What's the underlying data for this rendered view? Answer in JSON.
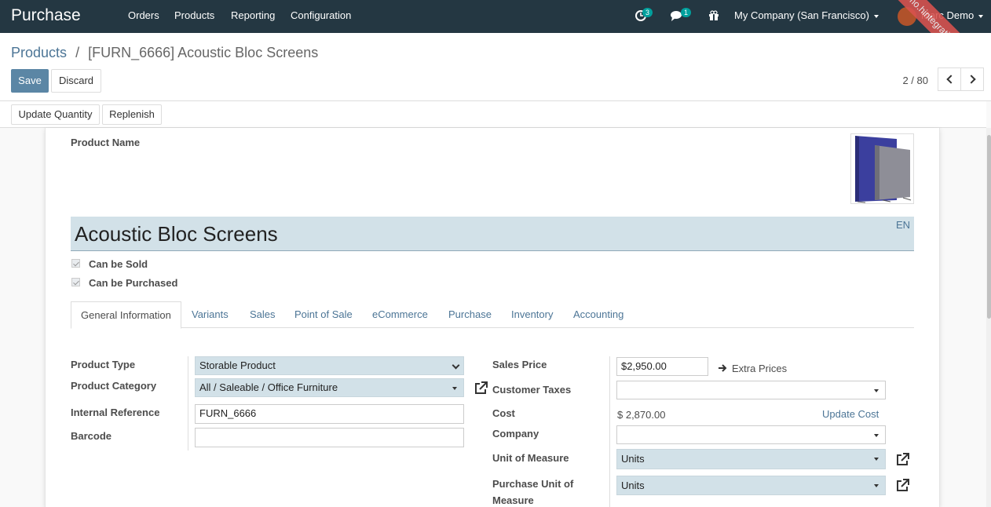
{
  "navbar": {
    "app_title": "Purchase",
    "menu": [
      "Orders",
      "Products",
      "Reporting",
      "Configuration"
    ],
    "activity_count": "3",
    "messages_count": "1",
    "company": "My Company (San Francisco)",
    "user": "Marc Demo",
    "ribbon": "(demo.hintegration.com) Sinnop Test"
  },
  "control": {
    "breadcrumb_parent": "Products",
    "breadcrumb_sep": "/",
    "breadcrumb_current": "[FURN_6666] Acoustic Bloc Screens",
    "save_label": "Save",
    "discard_label": "Discard",
    "pager": "2 / 80"
  },
  "status": {
    "update_quantity": "Update Quantity",
    "replenish": "Replenish"
  },
  "form": {
    "product_name_label": "Product Name",
    "product_name": "Acoustic Bloc Screens",
    "lang": "EN",
    "can_be_sold": "Can be Sold",
    "can_be_purchased": "Can be Purchased",
    "tabs": [
      "General Information",
      "Variants",
      "Sales",
      "Point of Sale",
      "eCommerce",
      "Purchase",
      "Inventory",
      "Accounting"
    ],
    "left": {
      "product_type_label": "Product Type",
      "product_type": "Storable Product",
      "product_category_label": "Product Category",
      "product_category": "All / Saleable / Office Furniture",
      "internal_ref_label": "Internal Reference",
      "internal_ref": "FURN_6666",
      "barcode_label": "Barcode",
      "barcode": ""
    },
    "right": {
      "sales_price_label": "Sales Price",
      "sales_price": "$2,950.00",
      "extra_prices": "Extra Prices",
      "customer_taxes_label": "Customer Taxes",
      "cost_label": "Cost",
      "cost": "$ 2,870.00",
      "update_cost": "Update Cost",
      "company_label": "Company",
      "uom_label": "Unit of Measure",
      "uom": "Units",
      "purchase_uom_label_1": "Purchase Unit of",
      "purchase_uom_label_2": "Measure",
      "purchase_uom": "Units"
    }
  },
  "colors": {
    "navbar": "#243742",
    "primary": "#5b86a5",
    "required_field": "#d2e1e8",
    "link": "#4c7596",
    "ribbon": "#d9534f"
  }
}
